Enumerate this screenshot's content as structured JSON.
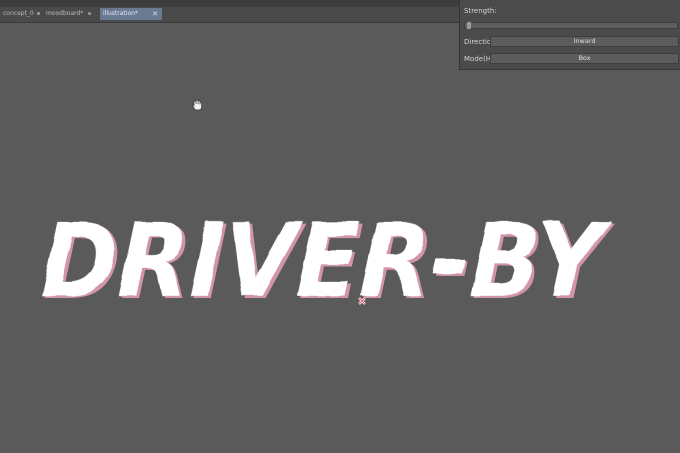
{
  "tabs": [
    {
      "label": "concept_0",
      "active": false
    },
    {
      "label": "moodboard*",
      "active": false
    },
    {
      "label": "illustration*",
      "active": true
    }
  ],
  "panel": {
    "strength_label": "Strength:",
    "strength_value": 0.0,
    "direction_label": "Direction",
    "direction_value": "Inward",
    "mode_label": "Mode(H)",
    "mode_value": "Box"
  },
  "canvas": {
    "title_text": "DRIVER-BY"
  },
  "colors": {
    "canvas_bg": "#5a5a5a",
    "text_fill": "#ffffff",
    "text_shadow": "#e8a0b4"
  }
}
